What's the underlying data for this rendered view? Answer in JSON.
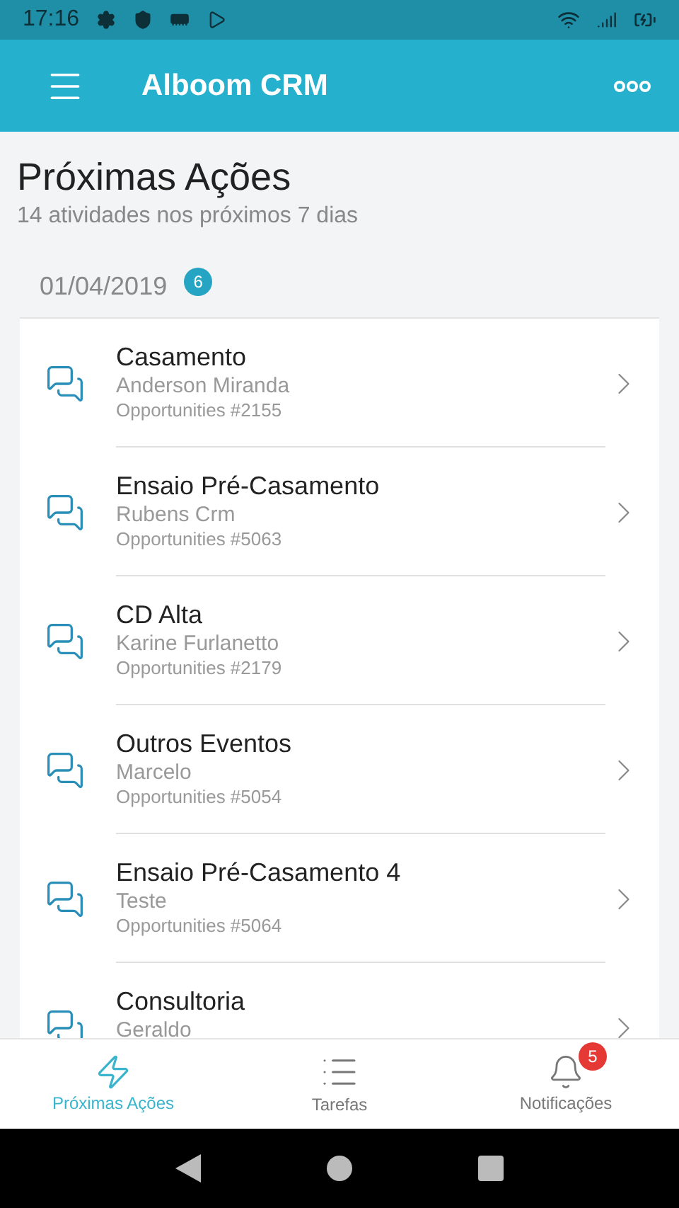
{
  "status_bar": {
    "time": "17:16"
  },
  "app_bar": {
    "title": "Alboom CRM"
  },
  "header": {
    "title": "Próximas Ações",
    "subtitle": "14 atividades nos próximos 7 dias"
  },
  "date_group": {
    "date": "01/04/2019",
    "count": "6"
  },
  "items": [
    {
      "title": "Casamento",
      "contact": "Anderson Miranda",
      "reference": "Opportunities #2155"
    },
    {
      "title": "Ensaio Pré-Casamento",
      "contact": "Rubens Crm",
      "reference": "Opportunities #5063"
    },
    {
      "title": "CD Alta",
      "contact": "Karine Furlanetto",
      "reference": "Opportunities #2179"
    },
    {
      "title": "Outros Eventos",
      "contact": "Marcelo",
      "reference": "Opportunities #5054"
    },
    {
      "title": "Ensaio Pré-Casamento 4",
      "contact": "Teste",
      "reference": "Opportunities #5064"
    },
    {
      "title": "Consultoria",
      "contact": "Geraldo"
    }
  ],
  "bottom_nav": [
    {
      "kind": "actions",
      "label": "Próximas Ações",
      "selected": true
    },
    {
      "kind": "tasks",
      "label": "Tarefas",
      "selected": false
    },
    {
      "kind": "notifications",
      "label": "Notificações",
      "selected": false,
      "badge": "5"
    }
  ]
}
